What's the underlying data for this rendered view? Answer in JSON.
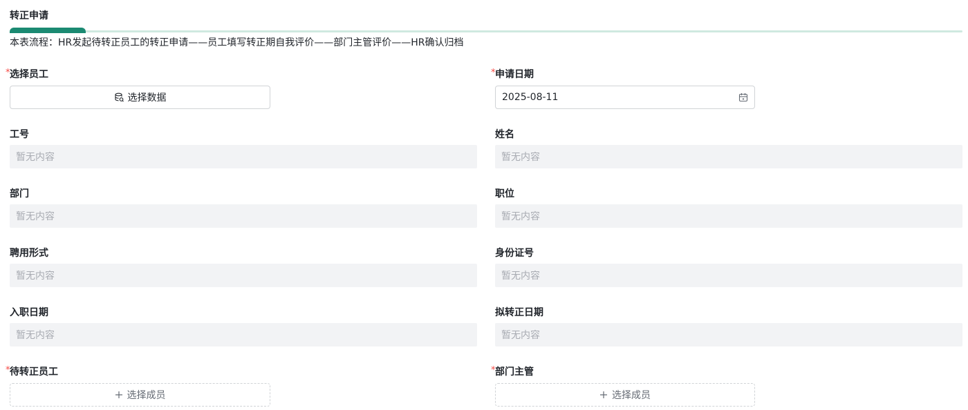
{
  "section": {
    "title": "转正申请",
    "flow_desc": "本表流程：HR发起待转正员工的转正申请——员工填写转正期自我评价——部门主管评价——HR确认归档"
  },
  "form": {
    "required_mark": "*",
    "empty_text": "暂无内容",
    "employee": {
      "label": "选择员工",
      "button_label": "选择数据",
      "icon": "database-icon"
    },
    "apply_date": {
      "label": "申请日期",
      "value": "2025-08-11",
      "icon": "calendar-icon"
    },
    "emp_no": {
      "label": "工号"
    },
    "name": {
      "label": "姓名"
    },
    "department": {
      "label": "部门"
    },
    "position": {
      "label": "职位"
    },
    "employment_type": {
      "label": "聘用形式"
    },
    "id_number": {
      "label": "身份证号"
    },
    "hire_date": {
      "label": "入职日期"
    },
    "regularization_date": {
      "label": "拟转正日期"
    },
    "pending_employee": {
      "label": "待转正员工",
      "button_label": "选择成员",
      "icon": "plus-icon"
    },
    "dept_manager": {
      "label": "部门主管",
      "button_label": "选择成员",
      "icon": "plus-icon"
    }
  },
  "colors": {
    "accent": "#1b8a72",
    "required": "#f54a45",
    "readonly_bg": "#f2f3f5"
  }
}
